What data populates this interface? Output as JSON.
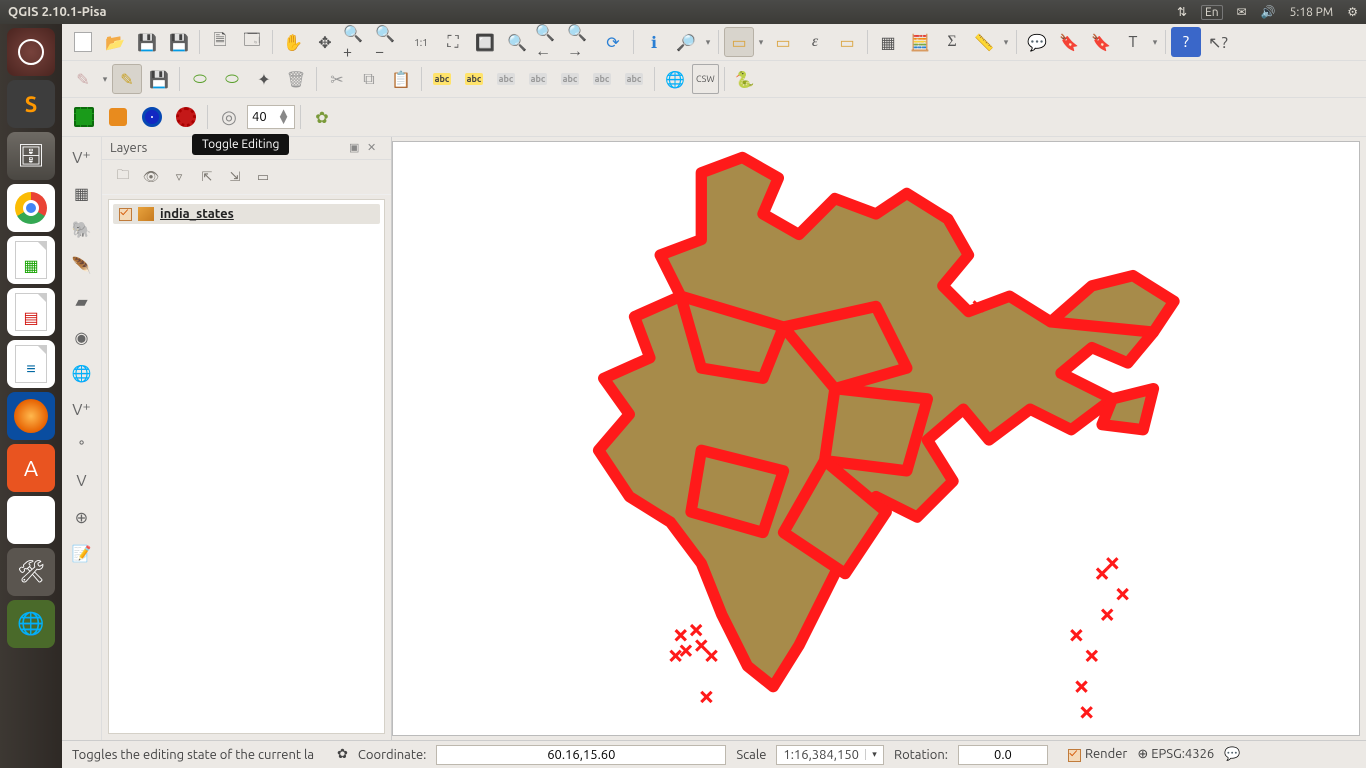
{
  "ubuntu": {
    "window_title": "QGIS 2.10.1-Pisa",
    "tray": {
      "lang": "En",
      "time": "5:18 PM"
    }
  },
  "tooltip": "Toggle Editing",
  "row3": {
    "number_value": "40"
  },
  "layers": {
    "title": "Layers",
    "items": [
      {
        "label": "india_states"
      }
    ]
  },
  "status": {
    "hint": "Toggles the editing state of the current la",
    "coord_label": "Coordinate:",
    "coord_value": "60.16,15.60",
    "scale_label": "Scale",
    "scale_value": "1:16,384,150",
    "rotation_label": "Rotation:",
    "rotation_value": "0.0",
    "render_label": "Render",
    "crs": "EPSG:4326"
  }
}
